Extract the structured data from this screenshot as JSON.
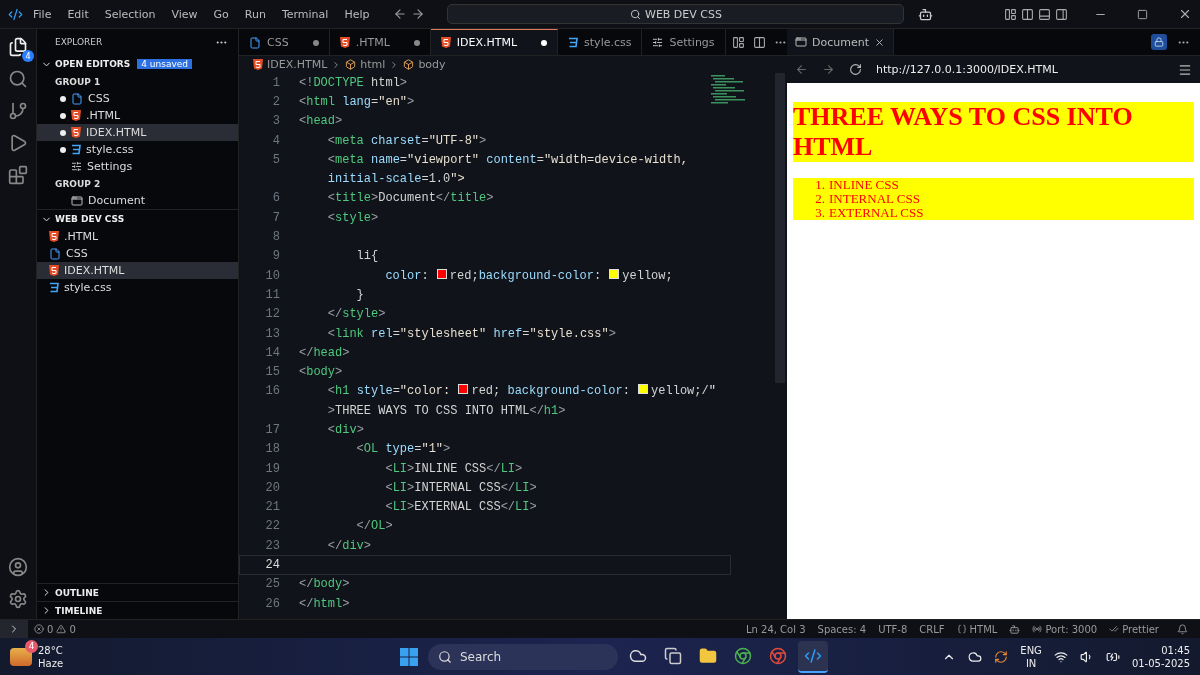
{
  "title_bar": {
    "menu": [
      "File",
      "Edit",
      "Selection",
      "View",
      "Go",
      "Run",
      "Terminal",
      "Help"
    ],
    "search": "WEB DEV CSS"
  },
  "activity_bar": {
    "explorer_badge": "4"
  },
  "sidebar": {
    "title": "EXPLORER",
    "open_editors": {
      "title": "OPEN EDITORS",
      "badge": "4 unsaved",
      "groups": [
        {
          "title": "GROUP 1",
          "items": [
            {
              "label": "CSS",
              "kind": "doc",
              "dirty": true,
              "selected": false
            },
            {
              "label": ".HTML",
              "kind": "html",
              "dirty": true,
              "selected": false
            },
            {
              "label": "IDEX.HTML",
              "kind": "html",
              "dirty": true,
              "selected": true
            },
            {
              "label": "style.css",
              "kind": "css",
              "dirty": true,
              "selected": false
            },
            {
              "label": "Settings",
              "kind": "settings",
              "dirty": false,
              "selected": false
            }
          ]
        },
        {
          "title": "GROUP 2",
          "items": [
            {
              "label": "Document",
              "kind": "preview",
              "dirty": false,
              "selected": false
            }
          ]
        }
      ]
    },
    "folder": {
      "title": "WEB DEV CSS",
      "expanded": true,
      "items": [
        {
          "label": ".HTML",
          "kind": "html",
          "selected": false
        },
        {
          "label": "CSS",
          "kind": "doc",
          "selected": false
        },
        {
          "label": "IDEX.HTML",
          "kind": "html",
          "selected": true
        },
        {
          "label": "style.css",
          "kind": "css",
          "selected": false
        }
      ]
    },
    "bottom_sections": [
      {
        "title": "OUTLINE",
        "expanded": false
      },
      {
        "title": "TIMELINE",
        "expanded": false
      }
    ]
  },
  "editor": {
    "tabs": [
      {
        "label": "CSS",
        "kind": "doc",
        "dirty": true,
        "selected": false
      },
      {
        "label": ".HTML",
        "kind": "html",
        "dirty": true,
        "selected": false
      },
      {
        "label": "IDEX.HTML",
        "kind": "html",
        "dirty": true,
        "selected": true
      },
      {
        "label": "style.css",
        "kind": "css",
        "dirty": false,
        "selected": false
      },
      {
        "label": "Settings",
        "kind": "settings",
        "dirty": false,
        "selected": false
      }
    ],
    "breadcrumb": [
      {
        "label": "IDEX.HTML",
        "kind": "html"
      },
      {
        "label": "html",
        "kind": "element"
      },
      {
        "label": "body",
        "kind": "element"
      }
    ],
    "lines": [
      {
        "number": "1",
        "current": false,
        "parts": [
          "<!DOCTYPE html>"
        ]
      },
      {
        "number": "2",
        "current": false,
        "parts": [
          "<html lang=\"en\">"
        ]
      },
      {
        "number": "3",
        "current": false,
        "parts": [
          "<head>"
        ]
      },
      {
        "number": "4",
        "current": false,
        "parts": [
          "    <meta charset=\"UTF-8\">"
        ]
      },
      {
        "number": "5",
        "current": false,
        "parts": [
          "    <meta name=\"viewport\" content=\"width=device-width,"
        ],
        "wrap": "    initial-scale=1.0\">"
      },
      {
        "number": "6",
        "current": false,
        "parts": [
          "    <title>Document</title>"
        ]
      },
      {
        "number": "7",
        "current": false,
        "parts": [
          "    <style>"
        ]
      },
      {
        "number": "8",
        "current": false
      },
      {
        "number": "9",
        "current": false,
        "parts": [
          "        li{"
        ]
      },
      {
        "number": "10",
        "current": false,
        "parts": [
          "            color: ",
          "red;background-color: ",
          "yellow;"
        ],
        "swatches": [
          {
            "color": "#ff0000"
          },
          {
            "color": "#ffff00"
          }
        ]
      },
      {
        "number": "11",
        "current": false,
        "parts": [
          "        }"
        ]
      },
      {
        "number": "12",
        "current": false,
        "parts": [
          "    </style>"
        ]
      },
      {
        "number": "13",
        "current": false,
        "parts": [
          "    <link rel=\"stylesheet\" href=\"style.css\">"
        ]
      },
      {
        "number": "14",
        "current": false,
        "parts": [
          "</head>"
        ]
      },
      {
        "number": "15",
        "current": false,
        "parts": [
          "<body>"
        ]
      },
      {
        "number": "16",
        "current": false,
        "parts": [
          "    <h1 style=\"color: ",
          "red; background-color: ",
          "yellow;/\""
        ],
        "swatches": [
          {
            "color": "#ff0000"
          },
          {
            "color": "#ffff00"
          }
        ],
        "wrap": "    >THREE WAYS TO CSS INTO HTML</h1>"
      },
      {
        "number": "17",
        "current": false,
        "parts": [
          "    <div>"
        ]
      },
      {
        "number": "18",
        "current": false,
        "parts": [
          "        <OL type=\"1\">"
        ]
      },
      {
        "number": "19",
        "current": false,
        "parts": [
          "            <LI>INLINE CSS</LI>"
        ]
      },
      {
        "number": "20",
        "current": false,
        "parts": [
          "            <LI>INTERNAL CSS</LI>"
        ]
      },
      {
        "number": "21",
        "current": false,
        "parts": [
          "            <LI>EXTERNAL CSS</LI>"
        ]
      },
      {
        "number": "22",
        "current": false,
        "parts": [
          "        </OL>"
        ]
      },
      {
        "number": "23",
        "current": false,
        "parts": [
          "    </div>"
        ]
      },
      {
        "number": "24",
        "current": true
      },
      {
        "number": "25",
        "current": false,
        "parts": [
          "</body>"
        ]
      },
      {
        "number": "26",
        "current": false,
        "parts": [
          "</html>"
        ]
      }
    ]
  },
  "preview": {
    "tab": "Document",
    "url": "http://127.0.0.1:3000/IDEX.HTML",
    "heading": "THREE WAYS TO CSS INTO HTML",
    "list": [
      {
        "marker": "1.",
        "text": "INLINE CSS"
      },
      {
        "marker": "2.",
        "text": "INTERNAL CSS"
      },
      {
        "marker": "3.",
        "text": "EXTERNAL CSS"
      }
    ]
  },
  "status_bar": {
    "errors": "0",
    "warnings": "0",
    "position": "Ln 24, Col 3",
    "spaces": "Spaces: 4",
    "encoding": "UTF-8",
    "eol": "CRLF",
    "language": "HTML",
    "port": "Port: 3000",
    "formatter": "Prettier"
  },
  "taskbar": {
    "weather_badge": "4",
    "temperature": "28°C",
    "condition": "Haze",
    "search": "Search",
    "apps": [
      {
        "selected": false
      },
      {
        "selected": false
      },
      {
        "selected": false
      },
      {
        "selected": false
      },
      {
        "selected": false
      },
      {
        "selected": true
      }
    ],
    "language": "ENG",
    "region": "IN",
    "time": "01:45",
    "date": "01-05-2025"
  }
}
